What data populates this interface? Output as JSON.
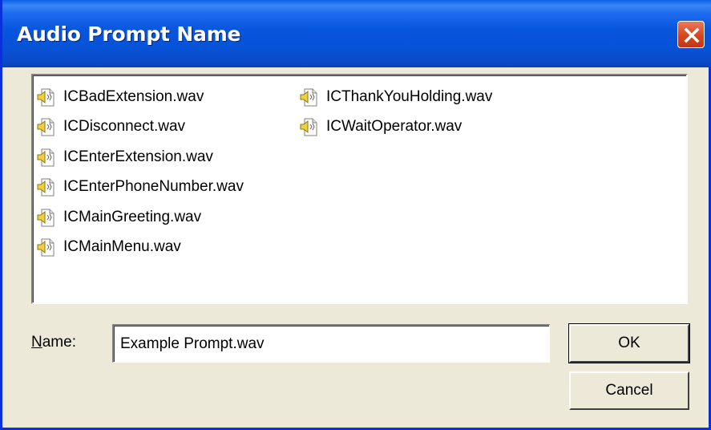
{
  "window": {
    "title": "Audio Prompt Name"
  },
  "file_list": {
    "items": [
      {
        "name": "ICBadExtension.wav",
        "icon": "audio-file-icon"
      },
      {
        "name": "ICDisconnect.wav",
        "icon": "audio-file-icon"
      },
      {
        "name": "ICEnterExtension.wav",
        "icon": "audio-file-icon"
      },
      {
        "name": "ICEnterPhoneNumber.wav",
        "icon": "audio-file-icon"
      },
      {
        "name": "ICMainGreeting.wav",
        "icon": "audio-file-icon"
      },
      {
        "name": "ICMainMenu.wav",
        "icon": "audio-file-icon"
      },
      {
        "name": "ICThankYouHolding.wav",
        "icon": "audio-file-icon"
      },
      {
        "name": "ICWaitOperator.wav",
        "icon": "audio-file-icon"
      }
    ]
  },
  "name_field": {
    "label_underlined": "N",
    "label_rest": "ame:",
    "value": "Example Prompt.wav"
  },
  "buttons": {
    "ok": "OK",
    "cancel": "Cancel"
  },
  "colors": {
    "titlebar": "#0A57DF",
    "close_button": "#D8451F",
    "dialog_face": "#ECE9D8"
  }
}
